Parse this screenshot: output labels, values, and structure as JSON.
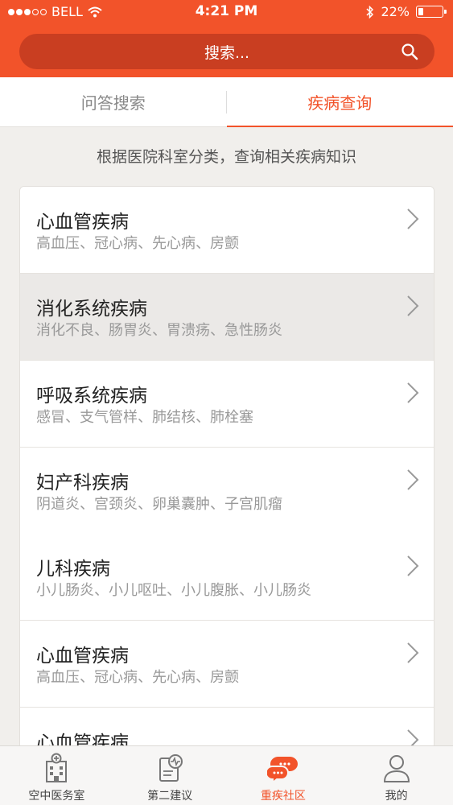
{
  "status_bar": {
    "carrier": "BELL",
    "time": "4:21 PM",
    "battery": "22%",
    "battery_level": 0.22,
    "icons": [
      "signal-dots-icon",
      "wifi-icon",
      "bluetooth-icon",
      "battery-icon"
    ]
  },
  "search": {
    "placeholder": "搜索...",
    "icon": "search-icon"
  },
  "tabs": [
    {
      "label": "问答搜索",
      "active": false
    },
    {
      "label": "疾病查询",
      "active": true
    }
  ],
  "subtitle": "根据医院科室分类，查询相关疾病知识",
  "list": [
    {
      "title": "心血管疾病",
      "subtitle": "高血压、冠心病、先心病、房颤",
      "highlighted": false
    },
    {
      "title": "消化系统疾病",
      "subtitle": "消化不良、肠胃炎、胃溃疡、急性肠炎",
      "highlighted": true
    },
    {
      "title": "呼吸系统疾病",
      "subtitle": "感冒、支气管样、肺结核、肺栓塞",
      "highlighted": false
    },
    {
      "title": "妇产科疾病",
      "subtitle": "阴道炎、宫颈炎、卵巢囊肿、子宫肌瘤",
      "highlighted": false
    },
    {
      "title": "儿科疾病",
      "subtitle": "小儿肠炎、小儿呕吐、小儿腹胀、小儿肠炎",
      "highlighted": false
    },
    {
      "title": "心血管疾病",
      "subtitle": "高血压、冠心病、先心病、房颤",
      "highlighted": false
    },
    {
      "title": "心血管疾病",
      "subtitle": "",
      "highlighted": false
    }
  ],
  "bottom_nav": [
    {
      "label": "空中医务室",
      "icon": "hospital-icon",
      "active": false
    },
    {
      "label": "第二建议",
      "icon": "clipboard-pulse-icon",
      "active": false
    },
    {
      "label": "重疾社区",
      "icon": "chat-bubbles-icon",
      "active": true
    },
    {
      "label": "我的",
      "icon": "user-icon",
      "active": false
    }
  ],
  "colors": {
    "accent": "#f2532a",
    "search_bg": "#c93e21",
    "page_bg": "#f1efec",
    "highlight_row": "#ebe9e7"
  }
}
